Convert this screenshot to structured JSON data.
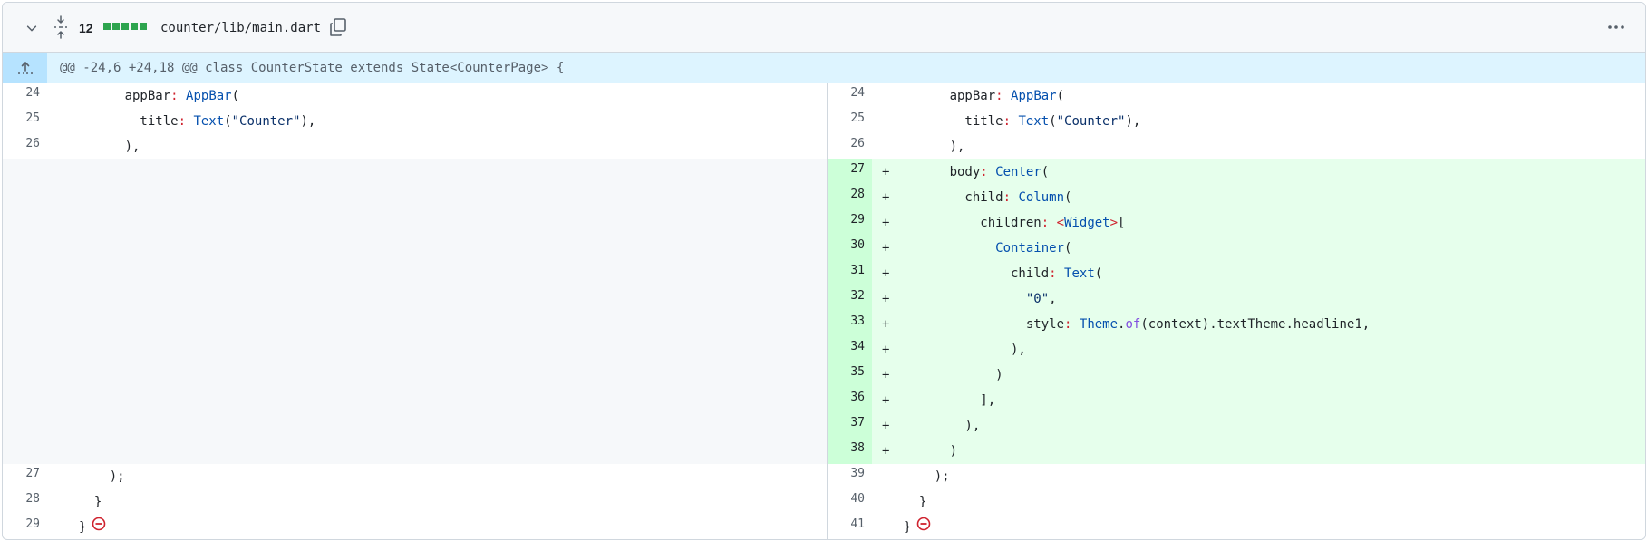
{
  "file": {
    "added_count": "12",
    "path": "counter/lib/main.dart"
  },
  "hunk": {
    "header": "@@ -24,6 +24,18 @@ class CounterState extends State<CounterPage> {"
  },
  "left": {
    "rows": [
      {
        "num": "24",
        "code": "      appBar: AppBar("
      },
      {
        "num": "25",
        "code": "        title: Text(\"Counter\"),"
      },
      {
        "num": "26",
        "code": "      ),"
      },
      {
        "num": "27",
        "code": "    );"
      },
      {
        "num": "28",
        "code": "  }"
      },
      {
        "num": "29",
        "code": "}"
      }
    ]
  },
  "right": {
    "rows": [
      {
        "num": "24",
        "code": "      appBar: AppBar("
      },
      {
        "num": "25",
        "code": "        title: Text(\"Counter\"),"
      },
      {
        "num": "26",
        "code": "      ),"
      },
      {
        "num": "27",
        "mark": "+",
        "code": "      body: Center("
      },
      {
        "num": "28",
        "mark": "+",
        "code": "        child: Column("
      },
      {
        "num": "29",
        "mark": "+",
        "code": "          children: <Widget>["
      },
      {
        "num": "30",
        "mark": "+",
        "code": "            Container("
      },
      {
        "num": "31",
        "mark": "+",
        "code": "              child: Text("
      },
      {
        "num": "32",
        "mark": "+",
        "code": "                \"0\","
      },
      {
        "num": "33",
        "mark": "+",
        "code": "                style: Theme.of(context).textTheme.headline1,"
      },
      {
        "num": "34",
        "mark": "+",
        "code": "              ),"
      },
      {
        "num": "35",
        "mark": "+",
        "code": "            )"
      },
      {
        "num": "36",
        "mark": "+",
        "code": "          ],"
      },
      {
        "num": "37",
        "mark": "+",
        "code": "        ),"
      },
      {
        "num": "38",
        "mark": "+",
        "code": "      )"
      },
      {
        "num": "39",
        "code": "    );"
      },
      {
        "num": "40",
        "code": "  }"
      },
      {
        "num": "41",
        "code": "}"
      }
    ]
  },
  "colors": {
    "addition_bg": "#e6ffec",
    "addition_num_bg": "#ccffd8",
    "hunk_bg": "#ddf4ff",
    "keyword_blue": "#0550ae",
    "operator_red": "#cf222e",
    "no_newline_red": "#cf222e"
  },
  "icons": [
    "chevron-down-icon",
    "unfold-icon",
    "copy-icon",
    "kebab-horizontal-icon",
    "expand-up-icon",
    "no-newline-icon"
  ]
}
